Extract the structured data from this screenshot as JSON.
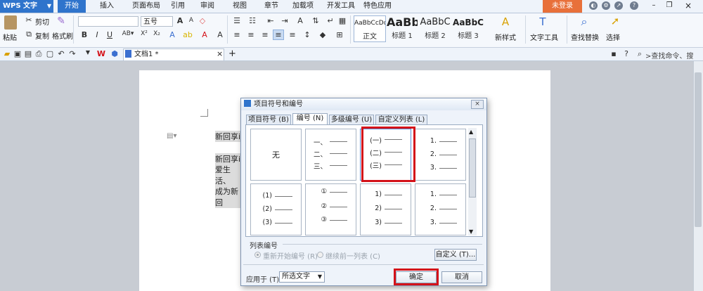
{
  "app": {
    "name": "WPS 文字",
    "login": "未登录"
  },
  "menus": [
    "开始",
    "插入",
    "页面布局",
    "引用",
    "审阅",
    "视图",
    "章节",
    "加载项",
    "开发工具",
    "特色应用"
  ],
  "ribbon": {
    "paste": "粘贴",
    "cut": "剪切",
    "copy": "复制",
    "format_painter": "格式刷",
    "font_name": "",
    "font_size": "五号",
    "styles": [
      {
        "sample": "AaBbCcDd",
        "name": "正文"
      },
      {
        "sample": "AaBb",
        "name": "标题 1"
      },
      {
        "sample": "AaBbC",
        "name": "标题 2"
      },
      {
        "sample": "AaBbC",
        "name": "标题 3"
      }
    ],
    "new_style": "新样式",
    "text_tools": "文字工具",
    "find_replace": "查找替换",
    "select": "选择"
  },
  "quickbar": {
    "doc_tab": "文档1 *",
    "search": ">查找命令、搜索..."
  },
  "document": {
    "lines": [
      "新回享i",
      "新回享i",
      "爱生活、",
      "成为新回"
    ]
  },
  "dialog": {
    "title": "项目符号和编号",
    "close": "×",
    "tabs": [
      "项目符号 (B)",
      "编号 (N)",
      "多级编号 (U)",
      "自定义列表 (L)"
    ],
    "none_label": "无",
    "cells": [
      [
        "一、",
        "二、",
        "三、"
      ],
      [
        "(一)",
        "(二)",
        "(三)"
      ],
      [
        "1.",
        "2.",
        "3."
      ],
      [
        "(1)",
        "(2)",
        "(3)"
      ],
      [
        "①",
        "②",
        "③"
      ],
      [
        "1)",
        "2)",
        "3)"
      ],
      [
        "1.",
        "2.",
        "3."
      ]
    ],
    "list_numbering": "列表编号",
    "restart": "重新开始编号 (R)",
    "continue": "继续前一列表 (C)",
    "customize": "自定义 (T)...",
    "apply_to_label": "应用于 (T):",
    "apply_to_value": "所选文字",
    "ok": "确定",
    "cancel": "取消"
  },
  "colors": {
    "accent": "#2f74cc",
    "login": "#e8703a",
    "highlight": "#d41219"
  }
}
